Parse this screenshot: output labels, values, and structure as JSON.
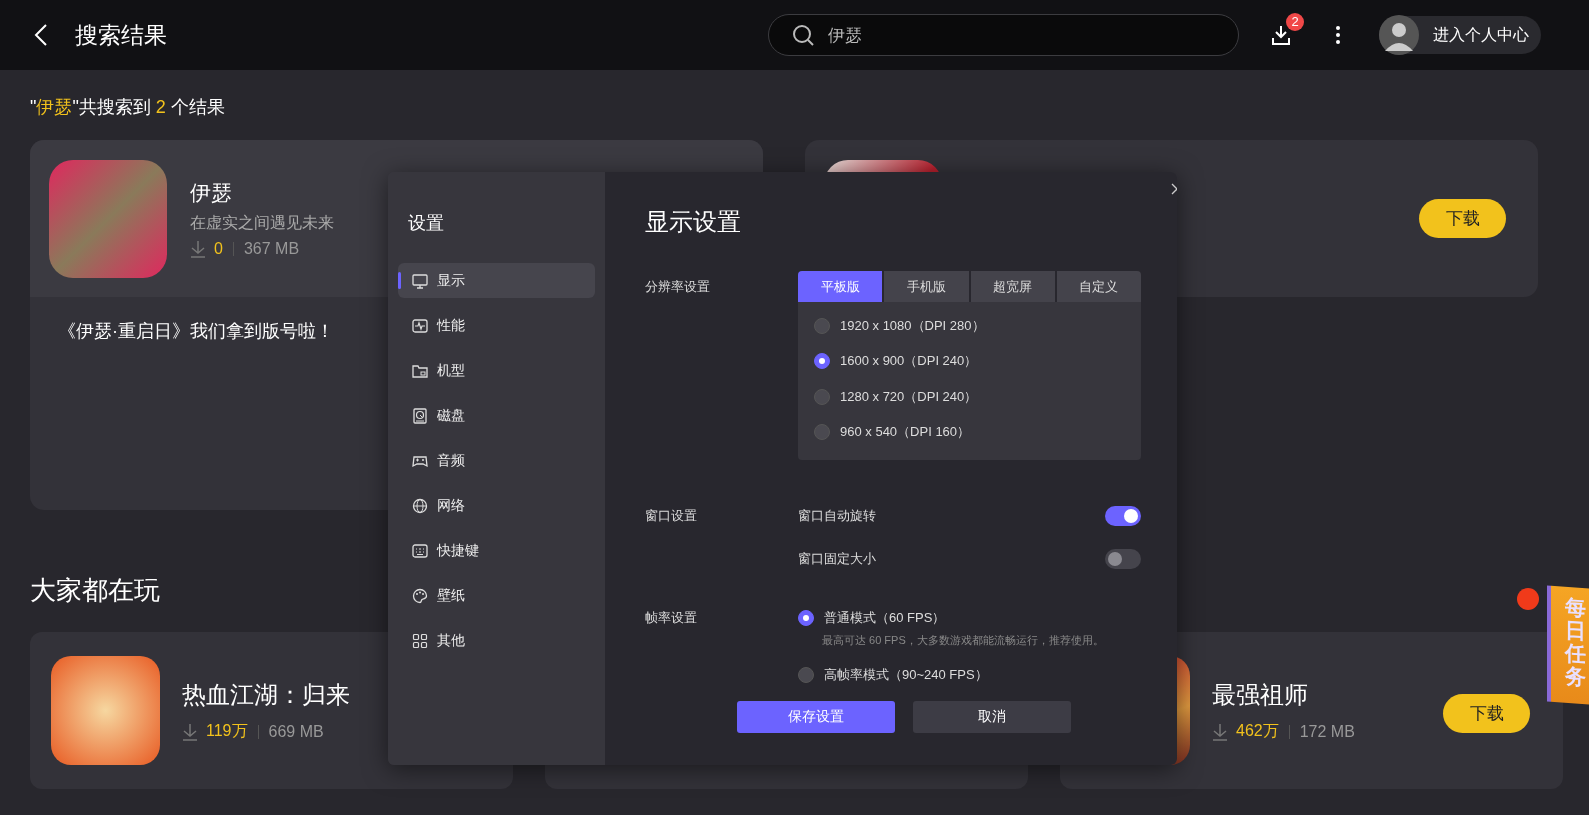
{
  "header": {
    "title": "搜索结果",
    "search": {
      "value": "伊瑟"
    },
    "download_count": "2",
    "profile_label": "进入个人中心"
  },
  "summary": [
    {
      "text": "\"",
      "highlight": false
    },
    {
      "text": "伊瑟",
      "highlight": true
    },
    {
      "text": "\"共搜索到 ",
      "highlight": false
    },
    {
      "text": "2",
      "highlight": true
    },
    {
      "text": " 个结果",
      "highlight": false
    }
  ],
  "results": [
    {
      "title": "伊瑟",
      "subtitle": "在虚实之间遇见未来",
      "downloads": "0",
      "size": "367 MB",
      "news": "《伊瑟·重启日》我们拿到版号啦！"
    },
    {
      "button": "下载"
    }
  ],
  "popular": {
    "title": "大家都在玩",
    "games": [
      {
        "kind": "game",
        "title": "热血江湖：归来",
        "downloads": "119万",
        "size": "669 MB"
      },
      {
        "kind": "covered"
      },
      {
        "kind": "game",
        "title": "最强祖师",
        "downloads": "462万",
        "size": "172 MB",
        "button": "下载"
      }
    ]
  },
  "settings_dialog": {
    "sidebar_title": "设置",
    "items": [
      {
        "label": "显示",
        "selected": true
      },
      {
        "label": "性能",
        "selected": false
      },
      {
        "label": "机型",
        "selected": false
      },
      {
        "label": "磁盘",
        "selected": false
      },
      {
        "label": "音频",
        "selected": false
      },
      {
        "label": "网络",
        "selected": false
      },
      {
        "label": "快捷键",
        "selected": false
      },
      {
        "label": "壁纸",
        "selected": false
      },
      {
        "label": "其他",
        "selected": false
      }
    ],
    "title": "显示设置",
    "resolution": {
      "label": "分辨率设置",
      "tabs": [
        {
          "label": "平板版",
          "selected": true
        },
        {
          "label": "手机版",
          "selected": false
        },
        {
          "label": "超宽屏",
          "selected": false
        },
        {
          "label": "自定义",
          "selected": false
        }
      ],
      "options": [
        {
          "label": "1920 x 1080（DPI 280）",
          "selected": false
        },
        {
          "label": "1600 x 900（DPI 240）",
          "selected": true
        },
        {
          "label": "1280 x 720（DPI 240）",
          "selected": false
        },
        {
          "label": "960 x 540（DPI 160）",
          "selected": false
        }
      ]
    },
    "window": {
      "label": "窗口设置",
      "toggles": [
        {
          "label": "窗口自动旋转",
          "on": true
        },
        {
          "label": "窗口固定大小",
          "on": false
        }
      ]
    },
    "fps": {
      "label": "帧率设置",
      "options": [
        {
          "label": "普通模式（60 FPS）",
          "hint": "最高可达 60 FPS，大多数游戏都能流畅运行，推荐使用。",
          "selected": true
        },
        {
          "label": "高帧率模式（90~240 FPS）",
          "selected": false
        }
      ]
    },
    "save_button": "保存设置",
    "cancel_button": "取消"
  },
  "daily_task": {
    "label": "每日任务",
    "dot": true
  }
}
